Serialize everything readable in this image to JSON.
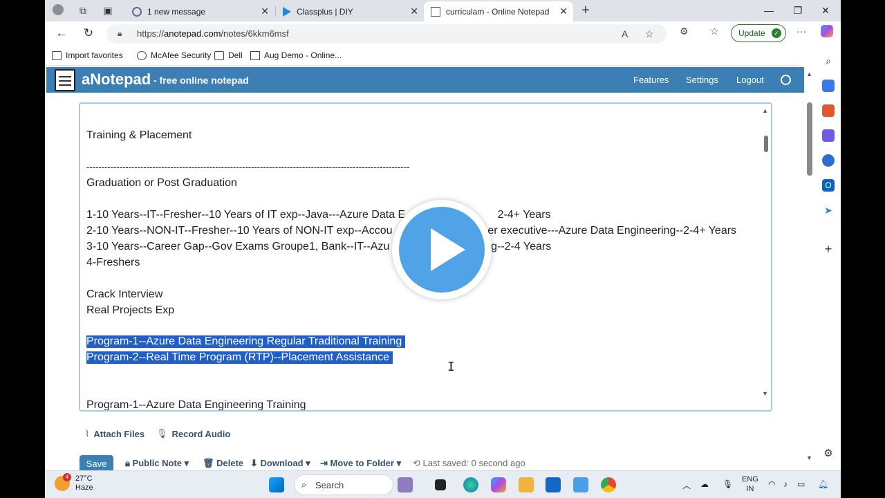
{
  "browser": {
    "tabs": [
      {
        "title": "1 new message",
        "active": false
      },
      {
        "title": "Classplus | DIY",
        "active": false
      },
      {
        "title": "curriculam - Online Notepad",
        "active": true
      }
    ],
    "url_prefix": "https://",
    "url_host": "anotepad.com",
    "url_path": "/notes/6kkm6msf",
    "update_label": "Update",
    "bookmarks": [
      "Import favorites",
      "McAfee Security",
      "Dell",
      "Aug Demo - Online..."
    ]
  },
  "site": {
    "brand": "aNotepad",
    "tagline": "- free online notepad",
    "nav": [
      "Features",
      "Settings",
      "Logout"
    ]
  },
  "note": {
    "lines": [
      "Training & Placement",
      "",
      "------------------------------------------------------------------------------------------------------------",
      "Graduation or Post Graduation",
      "",
      "1-10 Years--IT--Fresher--10 Years of IT exp--Java---Azure Data E                              2-4+ Years",
      "2-10 Years--NON-IT--Fresher--10 Years of NON-IT exp--Accou                            mer executive---Azure Data Engineering--2-4+ Years",
      "3-10 Years--Career Gap--Gov Exams Groupe1, Bank--IT--Azu                                 g--2-4 Years",
      "4-Freshers",
      "",
      "Crack Interview",
      "Real Projects Exp",
      "",
      "Program-1--Azure Data Engineering Regular Traditional Training ",
      "Program-2--Real Time Program (RTP)--Placement Assistance ",
      "",
      "",
      "Program-1--Azure Data Engineering Training"
    ]
  },
  "actions": {
    "attach_files": "Attach Files",
    "record_audio": "Record Audio",
    "save": "Save",
    "public_note": "Public Note",
    "delete": "Delete",
    "download": "Download",
    "move_to_folder": "Move to Folder",
    "last_saved": "Last saved: 0 second ago"
  },
  "taskbar": {
    "temperature": "27°C",
    "weather": "Haze",
    "weather_badge": "4",
    "search_placeholder": "Search",
    "lang_line1": "ENG",
    "lang_line2": "IN"
  },
  "colors": {
    "header": "#3b7fb5",
    "selection": "#1f5fc7",
    "play": "#4fa3e6"
  }
}
